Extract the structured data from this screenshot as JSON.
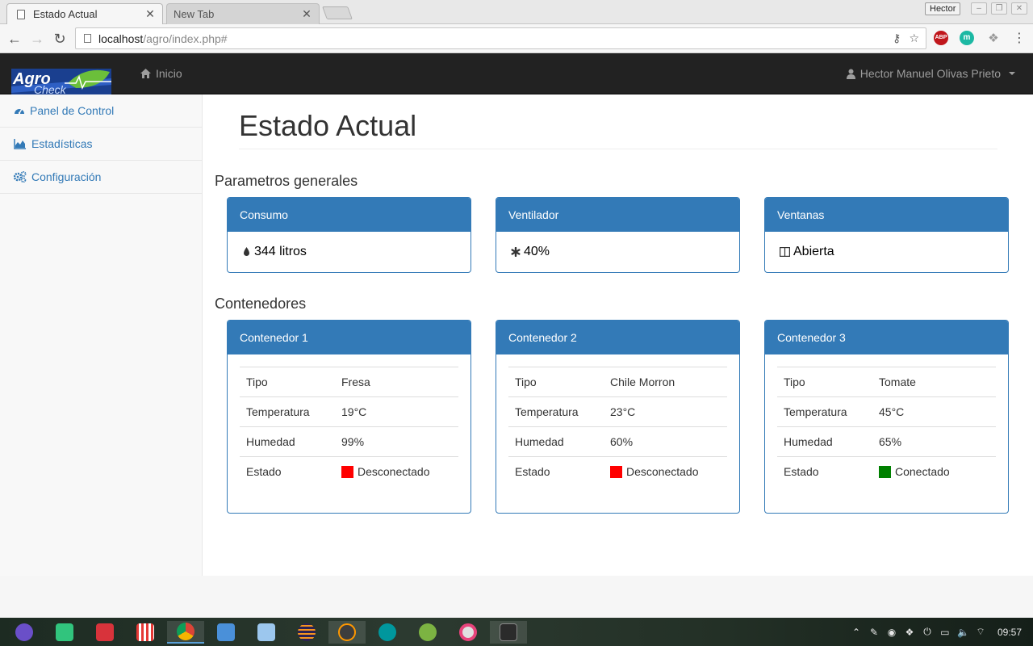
{
  "browser": {
    "active_tab": "Estado Actual",
    "inactive_tab": "New Tab",
    "profile_name": "Hector",
    "url_host": "localhost",
    "url_path": "/agro/index.php#",
    "extensions": [
      "ABP",
      "m"
    ]
  },
  "app": {
    "logo_top": "Agro",
    "logo_bottom": "Check",
    "nav_home": "Inicio",
    "user_name": "Hector Manuel Olivas Prieto"
  },
  "sidebar": {
    "items": [
      {
        "label": "Panel de Control",
        "icon": "dashboard-icon"
      },
      {
        "label": "Estadísticas",
        "icon": "area-chart-icon"
      },
      {
        "label": "Configuración",
        "icon": "cogs-icon"
      }
    ]
  },
  "main": {
    "title": "Estado Actual",
    "params_heading": "Parametros generales",
    "params": [
      {
        "title": "Consumo",
        "value": "344 litros",
        "icon": "tint-icon"
      },
      {
        "title": "Ventilador",
        "value": "40%",
        "icon": "asterisk-icon"
      },
      {
        "title": "Ventanas",
        "value": "Abierta",
        "icon": "window-icon"
      }
    ],
    "containers_heading": "Contenedores",
    "containers": [
      {
        "title": "Contenedor 1",
        "rows": [
          {
            "key": "Tipo",
            "value": "Fresa"
          },
          {
            "key": "Temperatura",
            "value": "19°C"
          },
          {
            "key": "Humedad",
            "value": "99%"
          },
          {
            "key": "Estado",
            "value": "Desconectado"
          }
        ],
        "status_color": "#ff0000"
      },
      {
        "title": "Contenedor 2",
        "rows": [
          {
            "key": "Tipo",
            "value": "Chile Morron"
          },
          {
            "key": "Temperatura",
            "value": "23°C"
          },
          {
            "key": "Humedad",
            "value": "60%"
          },
          {
            "key": "Estado",
            "value": "Desconectado"
          }
        ],
        "status_color": "#ff0000"
      },
      {
        "title": "Contenedor 3",
        "rows": [
          {
            "key": "Tipo",
            "value": "Tomate"
          },
          {
            "key": "Temperatura",
            "value": "45°C"
          },
          {
            "key": "Humedad",
            "value": "65%"
          },
          {
            "key": "Estado",
            "value": "Conectado"
          }
        ],
        "status_color": "#008000"
      }
    ]
  },
  "colors": {
    "primary": "#337ab7",
    "navbar": "#222222"
  },
  "taskbar": {
    "clock": "09:57"
  }
}
